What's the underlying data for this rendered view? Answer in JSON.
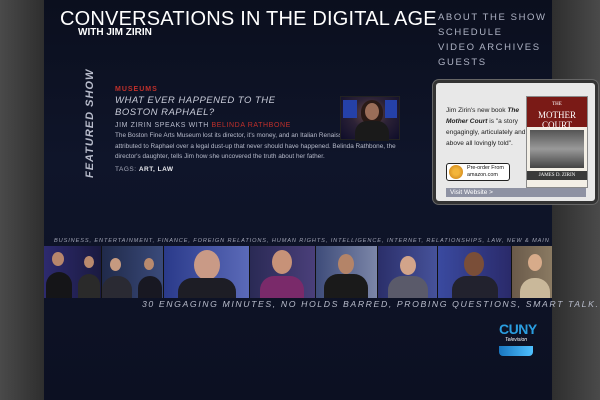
{
  "header": {
    "title": "CONVERSATIONS IN THE DIGITAL AGE",
    "subtitle": "WITH JIM ZIRIN"
  },
  "nav": {
    "items": [
      "ABOUT THE SHOW",
      "SCHEDULE",
      "VIDEO ARCHIVES",
      "GUESTS"
    ]
  },
  "featured": {
    "label": "FEATURED SHOW",
    "category": "MUSEUMS",
    "headline": "WHAT EVER HAPPENED TO THE BOSTON RAPHAEL?",
    "speaks_prefix": "JIM ZIRIN SPEAKS WITH",
    "guest": "BELINDA RATHBONE",
    "description": "The Boston Fine Arts Museum lost its director, it's money, and an Italian Renaissance painting attributed to Raphael over a legal dust-up that never should have happened. Belinda Rathbone, the director's daughter, tells Jim how she uncovered the truth about her father.",
    "tags_label": "TAGS:",
    "tags": "ART, LAW"
  },
  "book": {
    "text_prefix": "Jim Zirin's new book",
    "book_title": "The Mother Court",
    "text_suffix": "is \"a story engagingly, articulately and above all lovingly told\".",
    "cover_title": "MOTHER COURT",
    "cover_the": "THE",
    "cover_author": "JAMES D. ZIRIN",
    "preorder_line1": "Pre-order From",
    "preorder_line2": "amazon.com",
    "visit": "Visit Website >"
  },
  "topics": "BUSINESS, ENTERTAINMENT, FINANCE, FOREIGN RELATIONS, HUMAN RIGHTS, INTELLIGENCE, INTERNET, RELATIONSHIPS, LAW, NEW & MAINSTREAM MEDIA",
  "tagline": "30 ENGAGING MINUTES, NO HOLDS BARRED, PROBING QUESTIONS, SMART TALK.",
  "logo": {
    "name": "CUNY",
    "sub": "Television"
  }
}
